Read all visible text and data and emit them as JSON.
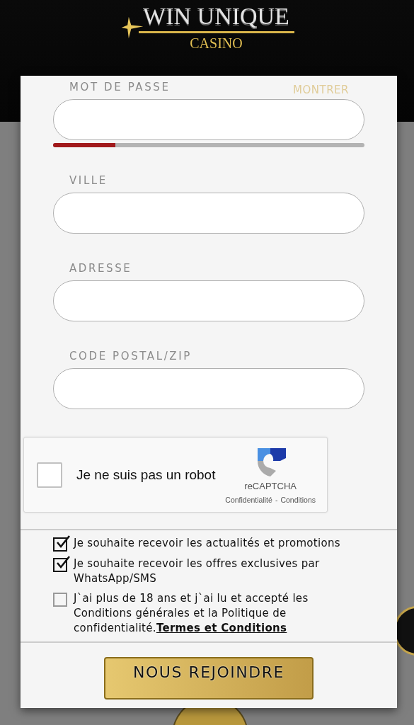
{
  "logo": {
    "name": "WIN UNIQUE",
    "subtitle": "CASINO"
  },
  "password": {
    "label": "MOT DE PASSE",
    "toggle": "MONTRER",
    "strength": {
      "level": 0.2
    }
  },
  "fields": [
    {
      "label": "VILLE"
    },
    {
      "label": "ADRESSE"
    },
    {
      "label": "CODE POSTAL/ZIP"
    }
  ],
  "captcha": {
    "label": "Je ne suis pas un robot",
    "checked": false,
    "brand": "reCAPTCHA",
    "privacy": "Confidentialité",
    "separator": "-",
    "terms": "Conditions"
  },
  "consents": [
    {
      "text": "Je souhaite recevoir les actualités et promotions",
      "checked": true
    },
    {
      "text": "Je souhaite recevoir les offres exclusives par WhatsApp/SMS",
      "checked": true
    },
    {
      "text": "J`ai plus de 18 ans et j`ai lu et accepté les Conditions générales et la Politique de confidentialité.",
      "link": "Termes et Conditions",
      "checked": false
    }
  ],
  "submit": "NOUS REJOINDRE"
}
